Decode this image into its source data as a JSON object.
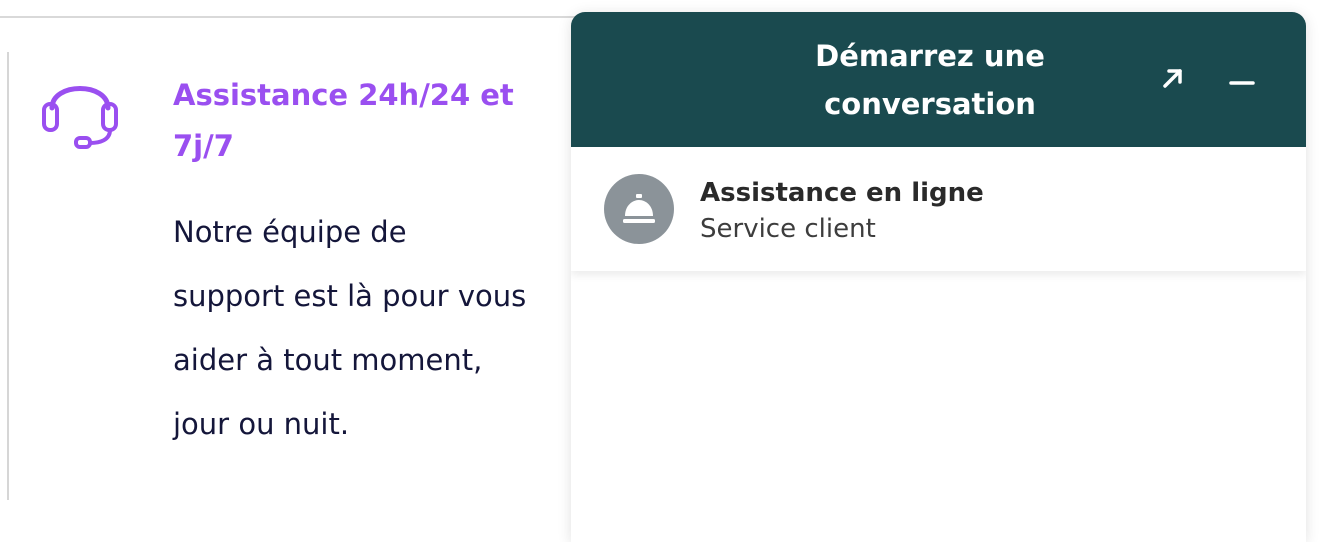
{
  "feature": {
    "icon": "headset-icon",
    "icon_color": "#9a4ff0",
    "title": "Assistance 24h/24 et 7j/7",
    "description_lines": [
      "Notre équipe de",
      "support est là pour vous",
      "aider à tout moment,",
      "jour ou nuit."
    ]
  },
  "chat": {
    "header_color": "#1a4a4f",
    "title": "Démarrez une conversation",
    "expand_icon": "arrow-up-right-icon",
    "minimize_icon": "minus-icon",
    "conversation": {
      "icon": "concierge-bell-icon",
      "name": "Assistance en ligne",
      "subtitle": "Service client"
    }
  }
}
